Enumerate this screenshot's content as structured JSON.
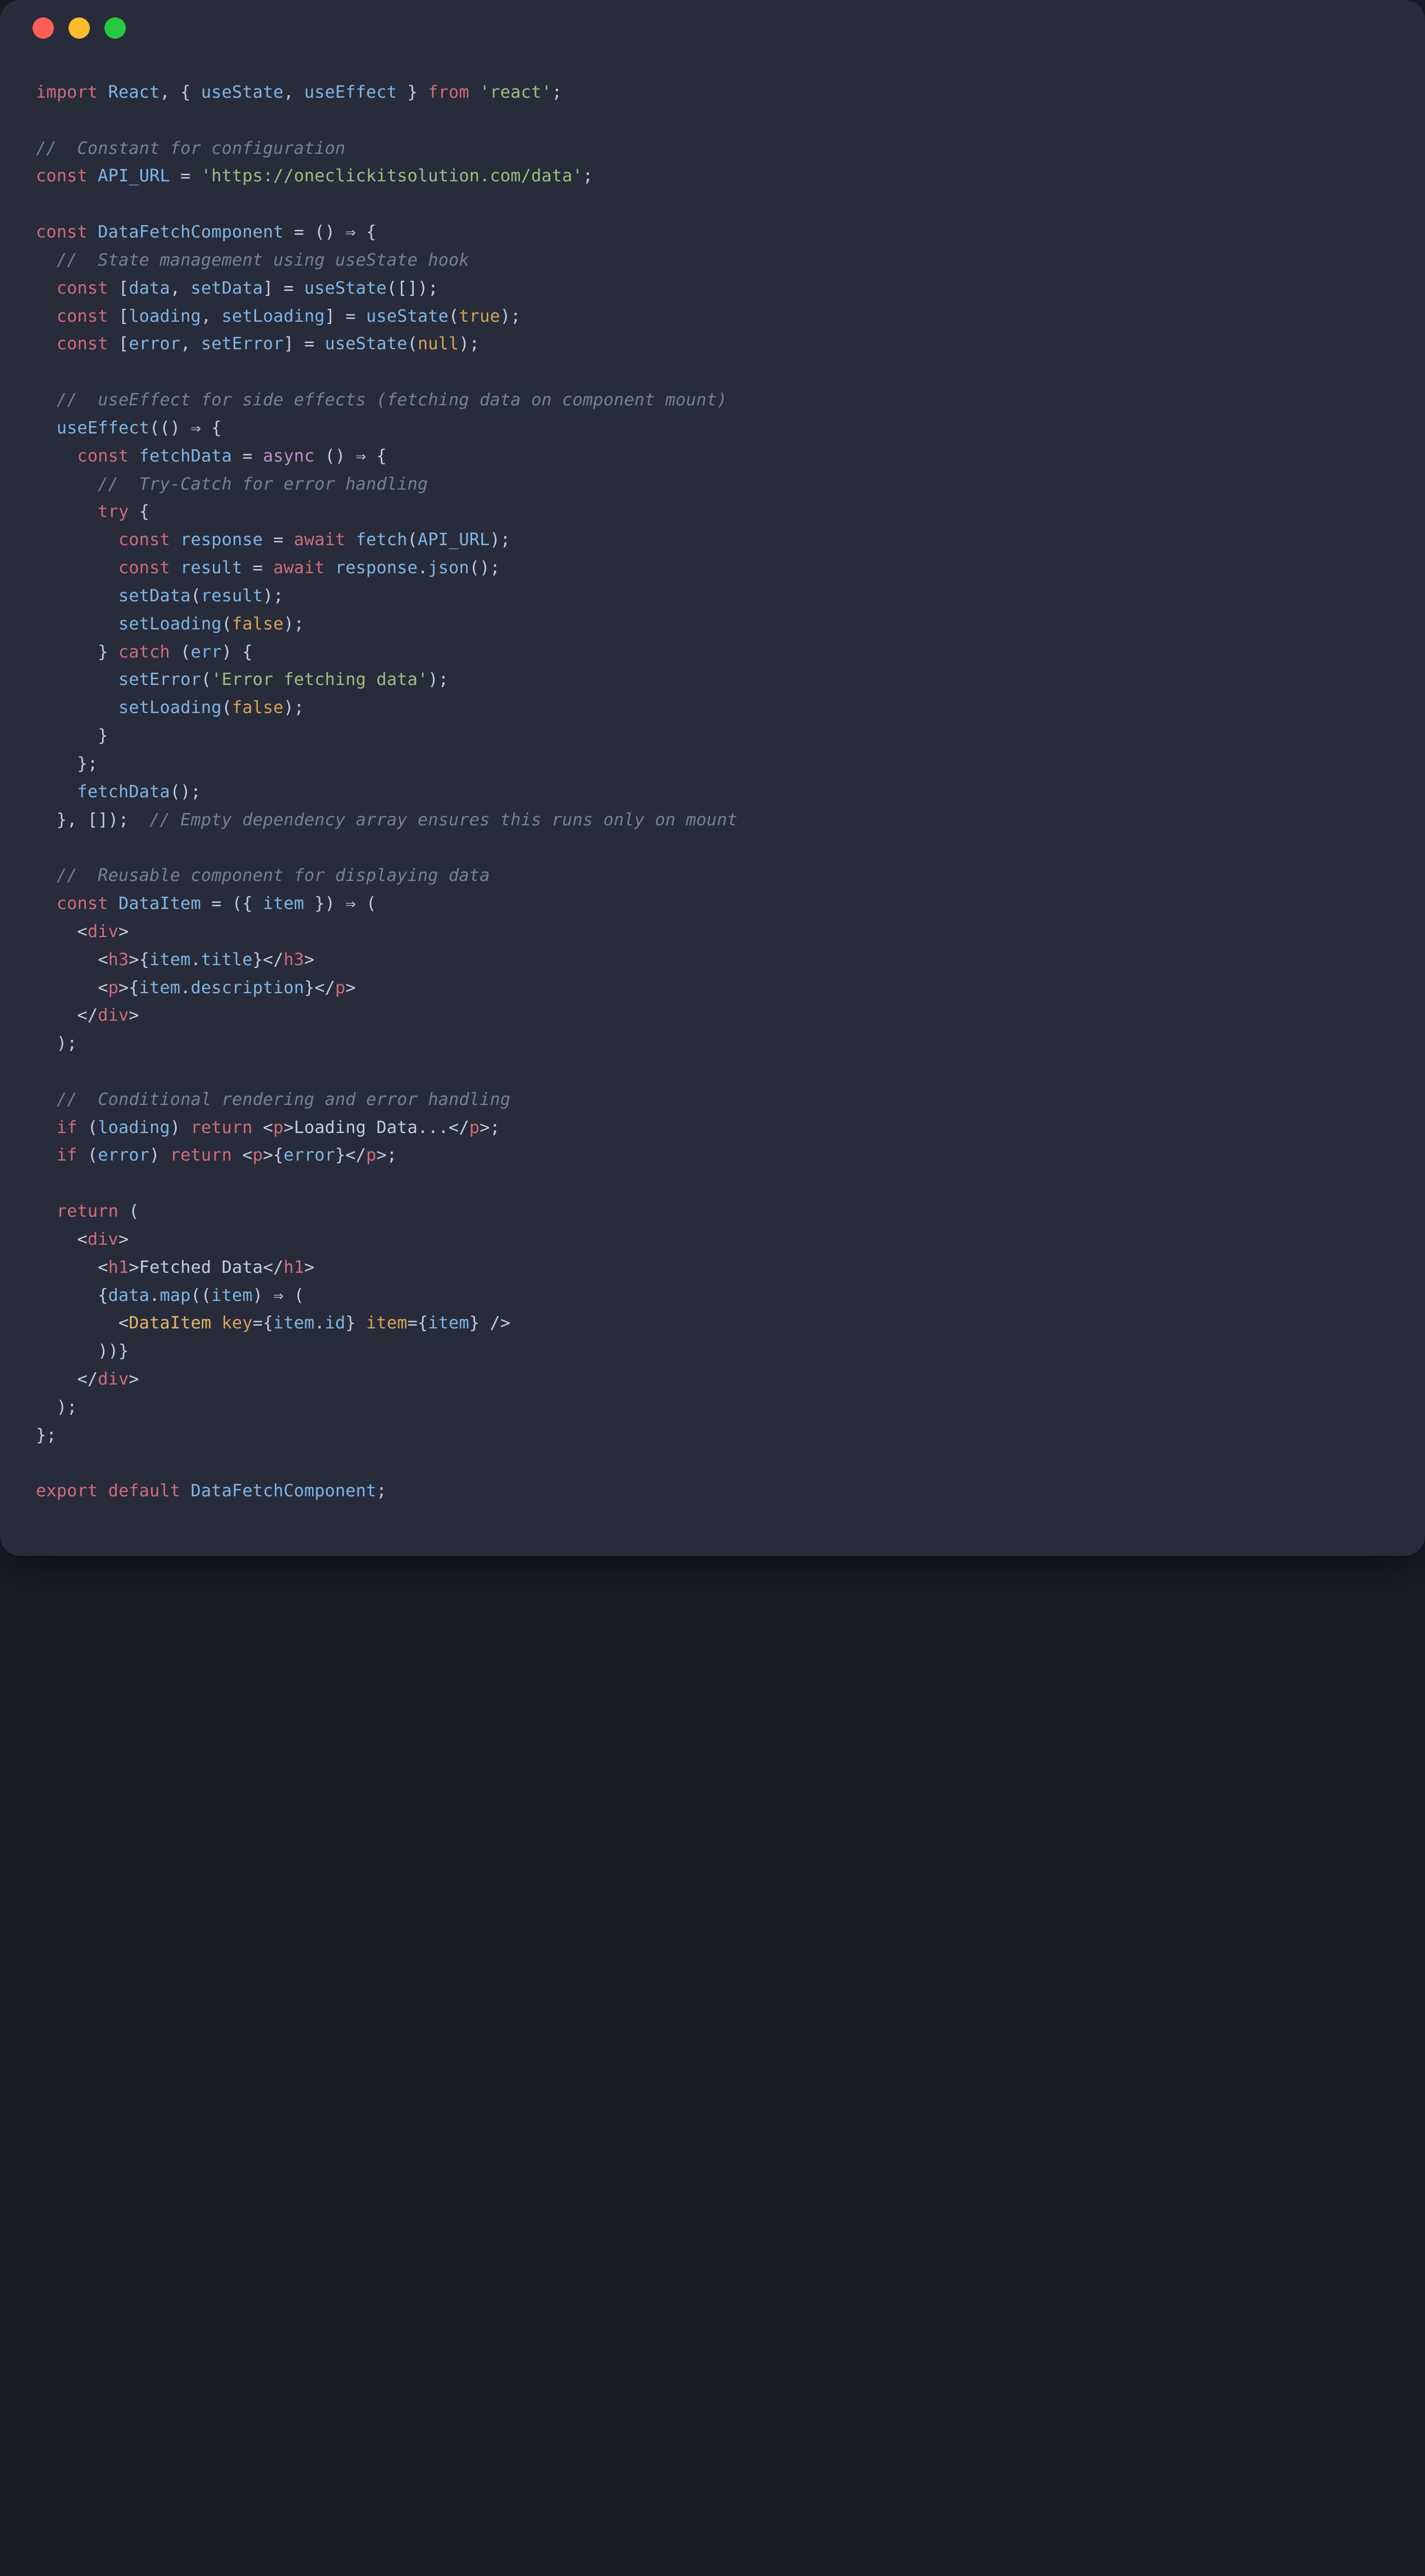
{
  "window": {
    "dots": [
      "red",
      "yellow",
      "green"
    ]
  },
  "code": {
    "lines": [
      [
        [
          "kw",
          "import"
        ],
        [
          "punc",
          " "
        ],
        [
          "fn",
          "React"
        ],
        [
          "punc",
          ", { "
        ],
        [
          "fn",
          "useState"
        ],
        [
          "punc",
          ", "
        ],
        [
          "fn",
          "useEffect"
        ],
        [
          "punc",
          " } "
        ],
        [
          "kw",
          "from"
        ],
        [
          "punc",
          " "
        ],
        [
          "str",
          "'react'"
        ],
        [
          "punc",
          ";"
        ]
      ],
      [],
      [
        [
          "cmt",
          "//  Constant for configuration"
        ]
      ],
      [
        [
          "kw",
          "const"
        ],
        [
          "punc",
          " "
        ],
        [
          "fn",
          "API_URL"
        ],
        [
          "punc",
          " = "
        ],
        [
          "str",
          "'https://oneclickitsolution.com/data'"
        ],
        [
          "punc",
          ";"
        ]
      ],
      [],
      [
        [
          "kw",
          "const"
        ],
        [
          "punc",
          " "
        ],
        [
          "fn",
          "DataFetchComponent"
        ],
        [
          "punc",
          " = () ⇒ {"
        ]
      ],
      [
        [
          "punc",
          "  "
        ],
        [
          "cmt",
          "//  State management using useState hook"
        ]
      ],
      [
        [
          "punc",
          "  "
        ],
        [
          "kw",
          "const"
        ],
        [
          "punc",
          " ["
        ],
        [
          "fn",
          "data"
        ],
        [
          "punc",
          ", "
        ],
        [
          "fn",
          "setData"
        ],
        [
          "punc",
          "] = "
        ],
        [
          "fn",
          "useState"
        ],
        [
          "punc",
          "([]);"
        ]
      ],
      [
        [
          "punc",
          "  "
        ],
        [
          "kw",
          "const"
        ],
        [
          "punc",
          " ["
        ],
        [
          "fn",
          "loading"
        ],
        [
          "punc",
          ", "
        ],
        [
          "fn",
          "setLoading"
        ],
        [
          "punc",
          "] = "
        ],
        [
          "fn",
          "useState"
        ],
        [
          "punc",
          "("
        ],
        [
          "bool",
          "true"
        ],
        [
          "punc",
          ");"
        ]
      ],
      [
        [
          "punc",
          "  "
        ],
        [
          "kw",
          "const"
        ],
        [
          "punc",
          " ["
        ],
        [
          "fn",
          "error"
        ],
        [
          "punc",
          ", "
        ],
        [
          "fn",
          "setError"
        ],
        [
          "punc",
          "] = "
        ],
        [
          "fn",
          "useState"
        ],
        [
          "punc",
          "("
        ],
        [
          "bool",
          "null"
        ],
        [
          "punc",
          ");"
        ]
      ],
      [],
      [
        [
          "punc",
          "  "
        ],
        [
          "cmt",
          "//  useEffect for side effects (fetching data on component mount)"
        ]
      ],
      [
        [
          "punc",
          "  "
        ],
        [
          "fn",
          "useEffect"
        ],
        [
          "punc",
          "(() ⇒ {"
        ]
      ],
      [
        [
          "punc",
          "    "
        ],
        [
          "kw",
          "const"
        ],
        [
          "punc",
          " "
        ],
        [
          "fn",
          "fetchData"
        ],
        [
          "punc",
          " = "
        ],
        [
          "async",
          "async"
        ],
        [
          "punc",
          " () ⇒ {"
        ]
      ],
      [
        [
          "punc",
          "      "
        ],
        [
          "cmt",
          "//  Try-Catch for error handling"
        ]
      ],
      [
        [
          "punc",
          "      "
        ],
        [
          "kw",
          "try"
        ],
        [
          "punc",
          " {"
        ]
      ],
      [
        [
          "punc",
          "        "
        ],
        [
          "kw",
          "const"
        ],
        [
          "punc",
          " "
        ],
        [
          "fn",
          "response"
        ],
        [
          "punc",
          " = "
        ],
        [
          "kw",
          "await"
        ],
        [
          "punc",
          " "
        ],
        [
          "fn",
          "fetch"
        ],
        [
          "punc",
          "("
        ],
        [
          "fn",
          "API_URL"
        ],
        [
          "punc",
          ");"
        ]
      ],
      [
        [
          "punc",
          "        "
        ],
        [
          "kw",
          "const"
        ],
        [
          "punc",
          " "
        ],
        [
          "fn",
          "result"
        ],
        [
          "punc",
          " = "
        ],
        [
          "kw",
          "await"
        ],
        [
          "punc",
          " "
        ],
        [
          "fn",
          "response"
        ],
        [
          "punc",
          "."
        ],
        [
          "fn",
          "json"
        ],
        [
          "punc",
          "();"
        ]
      ],
      [
        [
          "punc",
          "        "
        ],
        [
          "fn",
          "setData"
        ],
        [
          "punc",
          "("
        ],
        [
          "fn",
          "result"
        ],
        [
          "punc",
          ");"
        ]
      ],
      [
        [
          "punc",
          "        "
        ],
        [
          "fn",
          "setLoading"
        ],
        [
          "punc",
          "("
        ],
        [
          "bool",
          "false"
        ],
        [
          "punc",
          ");"
        ]
      ],
      [
        [
          "punc",
          "      } "
        ],
        [
          "kw",
          "catch"
        ],
        [
          "punc",
          " ("
        ],
        [
          "fn",
          "err"
        ],
        [
          "punc",
          ") {"
        ]
      ],
      [
        [
          "punc",
          "        "
        ],
        [
          "fn",
          "setError"
        ],
        [
          "punc",
          "("
        ],
        [
          "str",
          "'Error fetching data'"
        ],
        [
          "punc",
          ");"
        ]
      ],
      [
        [
          "punc",
          "        "
        ],
        [
          "fn",
          "setLoading"
        ],
        [
          "punc",
          "("
        ],
        [
          "bool",
          "false"
        ],
        [
          "punc",
          ");"
        ]
      ],
      [
        [
          "punc",
          "      }"
        ]
      ],
      [
        [
          "punc",
          "    };"
        ]
      ],
      [
        [
          "punc",
          "    "
        ],
        [
          "fn",
          "fetchData"
        ],
        [
          "punc",
          "();"
        ]
      ],
      [
        [
          "punc",
          "  }, []);  "
        ],
        [
          "cmt",
          "// Empty dependency array ensures this runs only on mount"
        ]
      ],
      [],
      [
        [
          "punc",
          "  "
        ],
        [
          "cmt",
          "//  Reusable component for displaying data"
        ]
      ],
      [
        [
          "punc",
          "  "
        ],
        [
          "kw",
          "const"
        ],
        [
          "punc",
          " "
        ],
        [
          "fn",
          "DataItem"
        ],
        [
          "punc",
          " = ({ "
        ],
        [
          "fn",
          "item"
        ],
        [
          "punc",
          " }) ⇒ ("
        ]
      ],
      [
        [
          "punc",
          "    <"
        ],
        [
          "html",
          "div"
        ],
        [
          "punc",
          ">"
        ]
      ],
      [
        [
          "punc",
          "      <"
        ],
        [
          "html",
          "h3"
        ],
        [
          "punc",
          ">{"
        ],
        [
          "fn",
          "item"
        ],
        [
          "punc",
          "."
        ],
        [
          "fn",
          "title"
        ],
        [
          "punc",
          "}</"
        ],
        [
          "html",
          "h3"
        ],
        [
          "punc",
          ">"
        ]
      ],
      [
        [
          "punc",
          "      <"
        ],
        [
          "html",
          "p"
        ],
        [
          "punc",
          ">{"
        ],
        [
          "fn",
          "item"
        ],
        [
          "punc",
          "."
        ],
        [
          "fn",
          "description"
        ],
        [
          "punc",
          "}</"
        ],
        [
          "html",
          "p"
        ],
        [
          "punc",
          ">"
        ]
      ],
      [
        [
          "punc",
          "    </"
        ],
        [
          "html",
          "div"
        ],
        [
          "punc",
          ">"
        ]
      ],
      [
        [
          "punc",
          "  );"
        ]
      ],
      [],
      [
        [
          "punc",
          "  "
        ],
        [
          "cmt",
          "//  Conditional rendering and error handling"
        ]
      ],
      [
        [
          "punc",
          "  "
        ],
        [
          "kw",
          "if"
        ],
        [
          "punc",
          " ("
        ],
        [
          "fn",
          "loading"
        ],
        [
          "punc",
          ") "
        ],
        [
          "kw",
          "return"
        ],
        [
          "punc",
          " <"
        ],
        [
          "html",
          "p"
        ],
        [
          "punc",
          ">Loading Data...</"
        ],
        [
          "html",
          "p"
        ],
        [
          "punc",
          ">;"
        ]
      ],
      [
        [
          "punc",
          "  "
        ],
        [
          "kw",
          "if"
        ],
        [
          "punc",
          " ("
        ],
        [
          "fn",
          "error"
        ],
        [
          "punc",
          ") "
        ],
        [
          "kw",
          "return"
        ],
        [
          "punc",
          " <"
        ],
        [
          "html",
          "p"
        ],
        [
          "punc",
          ">{"
        ],
        [
          "fn",
          "error"
        ],
        [
          "punc",
          "}</"
        ],
        [
          "html",
          "p"
        ],
        [
          "punc",
          ">;"
        ]
      ],
      [],
      [
        [
          "punc",
          "  "
        ],
        [
          "kw",
          "return"
        ],
        [
          "punc",
          " ("
        ]
      ],
      [
        [
          "punc",
          "    <"
        ],
        [
          "html",
          "div"
        ],
        [
          "punc",
          ">"
        ]
      ],
      [
        [
          "punc",
          "      <"
        ],
        [
          "html",
          "h1"
        ],
        [
          "punc",
          ">Fetched Data</"
        ],
        [
          "html",
          "h1"
        ],
        [
          "punc",
          ">"
        ]
      ],
      [
        [
          "punc",
          "      {"
        ],
        [
          "fn",
          "data"
        ],
        [
          "punc",
          "."
        ],
        [
          "fn",
          "map"
        ],
        [
          "punc",
          "(("
        ],
        [
          "fn",
          "item"
        ],
        [
          "punc",
          ") ⇒ ("
        ]
      ],
      [
        [
          "punc",
          "        <"
        ],
        [
          "type",
          "DataItem"
        ],
        [
          "punc",
          " "
        ],
        [
          "prop",
          "key"
        ],
        [
          "punc",
          "={"
        ],
        [
          "fn",
          "item"
        ],
        [
          "punc",
          "."
        ],
        [
          "fn",
          "id"
        ],
        [
          "punc",
          "} "
        ],
        [
          "prop",
          "item"
        ],
        [
          "punc",
          "={"
        ],
        [
          "fn",
          "item"
        ],
        [
          "punc",
          "} />"
        ]
      ],
      [
        [
          "punc",
          "      ))}"
        ]
      ],
      [
        [
          "punc",
          "    </"
        ],
        [
          "html",
          "div"
        ],
        [
          "punc",
          ">"
        ]
      ],
      [
        [
          "punc",
          "  );"
        ]
      ],
      [
        [
          "punc",
          "};"
        ]
      ],
      [],
      [
        [
          "kw",
          "export"
        ],
        [
          "punc",
          " "
        ],
        [
          "kw",
          "default"
        ],
        [
          "punc",
          " "
        ],
        [
          "fn",
          "DataFetchComponent"
        ],
        [
          "punc",
          ";"
        ]
      ]
    ]
  }
}
